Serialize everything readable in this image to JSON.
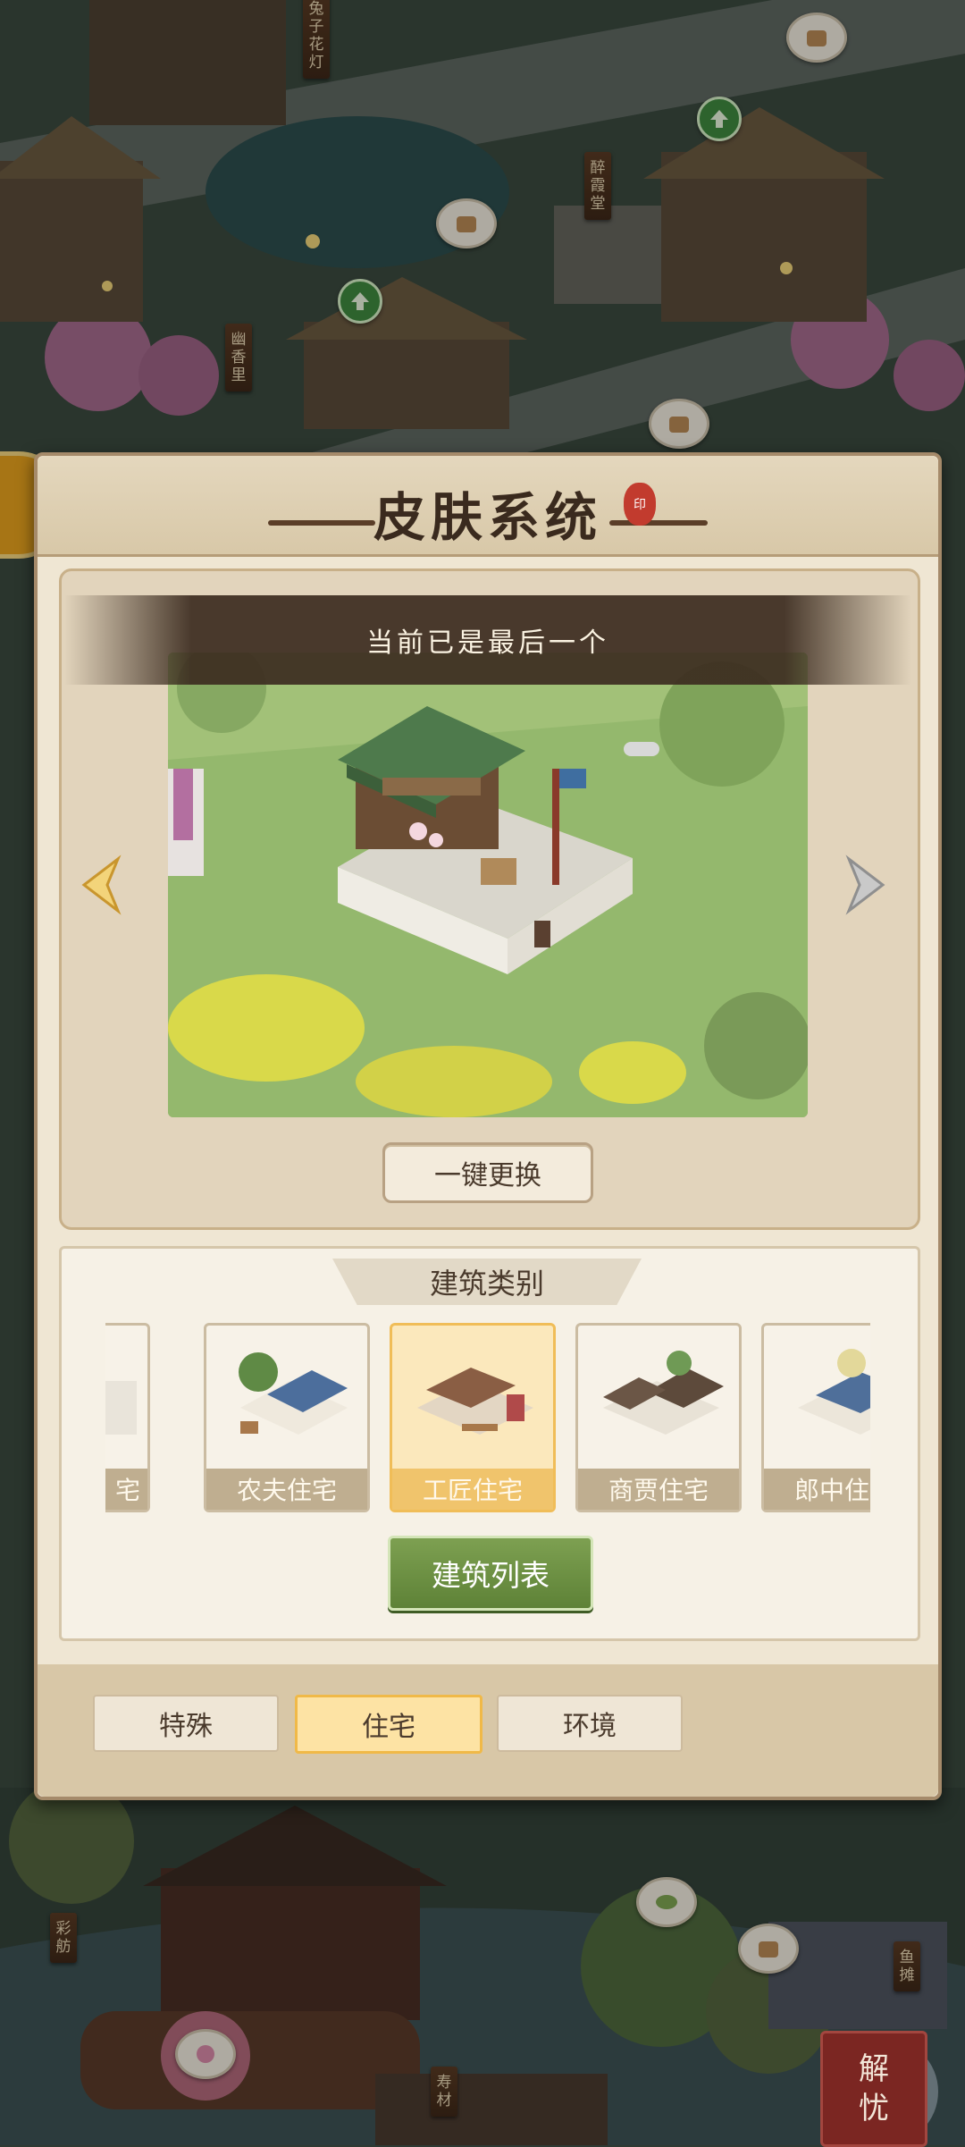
{
  "background": {
    "town_labels": [
      "兔子花灯",
      "醉霞堂",
      "幽香里",
      "彩舫",
      "鱼摊",
      "寿材"
    ],
    "corner_button": {
      "line1": "解",
      "line2": "忧"
    }
  },
  "panel": {
    "title": "皮肤系统",
    "preview": {
      "status_text": "当前已是最后一个",
      "prev_icon": "chevron-left-icon",
      "next_icon": "chevron-right-icon",
      "replace_button": "一键更换"
    },
    "category": {
      "header": "建筑类别",
      "cards": [
        {
          "label": "宅",
          "selected": false
        },
        {
          "label": "农夫住宅",
          "selected": false
        },
        {
          "label": "工匠住宅",
          "selected": true
        },
        {
          "label": "商贾住宅",
          "selected": false
        },
        {
          "label": "郎中住宅",
          "selected": false
        }
      ],
      "list_button": "建筑列表"
    },
    "tabs": [
      {
        "label": "特殊",
        "active": false
      },
      {
        "label": "住宅",
        "active": true
      },
      {
        "label": "环境",
        "active": false
      }
    ]
  },
  "colors": {
    "selected_card": "#fbe8bc",
    "active_tab": "#fde3a4",
    "list_button": "#6a8e42"
  }
}
